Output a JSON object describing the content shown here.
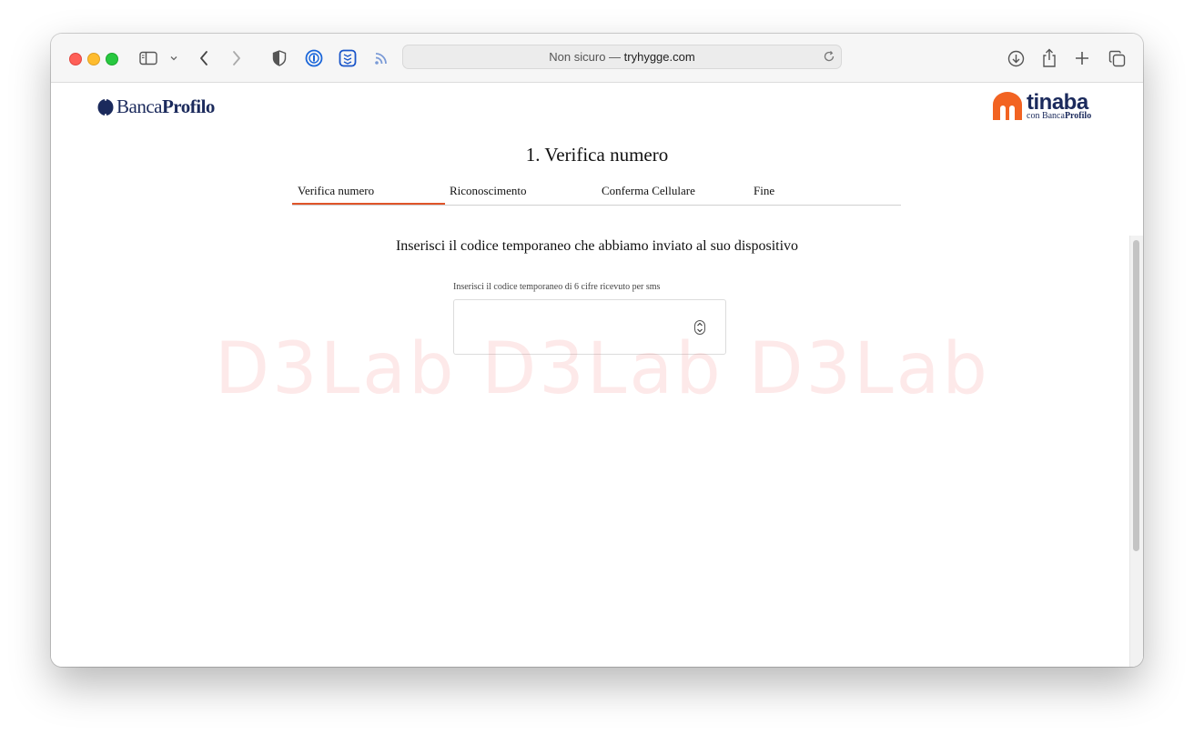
{
  "browser": {
    "url_prefix": "Non sicuro — ",
    "url_domain": "tryhygge.com"
  },
  "header": {
    "banca_logo_light": "Banca",
    "banca_logo_bold": "Profilo",
    "tinaba_name": "tinaba",
    "tinaba_sub_light": "con Banca",
    "tinaba_sub_bold": "Profilo"
  },
  "main": {
    "title": "1. Verifica numero",
    "steps": [
      {
        "label": "Verifica numero"
      },
      {
        "label": "Riconoscimento"
      },
      {
        "label": "Conferma Cellulare"
      },
      {
        "label": "Fine"
      }
    ],
    "instruction": "Inserisci il codice temporaneo che abbiamo inviato al suo dispositivo",
    "code_field": {
      "label": "Inserisci il codice temporaneo di 6 cifre ricevuto per sms",
      "value": "",
      "placeholder": ""
    }
  },
  "watermark": "D3Lab D3Lab D3Lab",
  "colors": {
    "accent": "#e0552a",
    "brand_navy": "#1b2a5c",
    "tinaba_orange": "#f26322"
  }
}
